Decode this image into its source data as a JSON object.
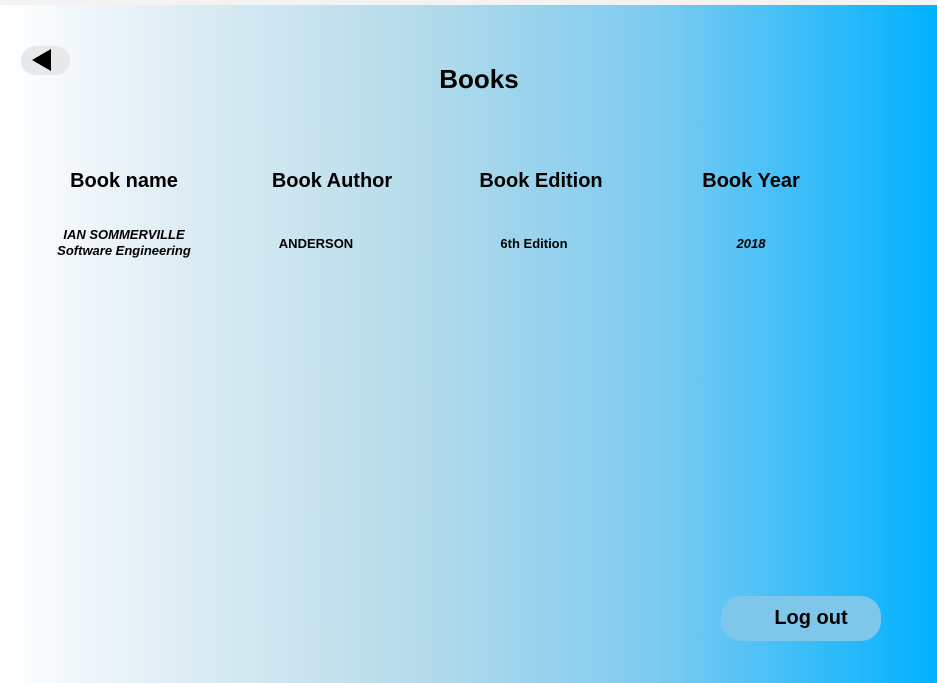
{
  "header": {
    "title": "Books",
    "back_icon": "back-arrow-icon"
  },
  "table": {
    "columns": [
      "Book name",
      "Book Author",
      "Book Edition",
      "Book Year"
    ],
    "rows": [
      {
        "name_line1": "IAN SOMMERVILLE",
        "name_line2": "Software Engineering",
        "author": "ANDERSON",
        "edition": "6th Edition",
        "year": "2018"
      }
    ]
  },
  "footer": {
    "logout_label": "Log out"
  },
  "colors": {
    "gradient_start": "#ffffff",
    "gradient_end": "#00b2ff",
    "logout_button": "#7fc7ea",
    "back_button": "#e6e8ea"
  }
}
